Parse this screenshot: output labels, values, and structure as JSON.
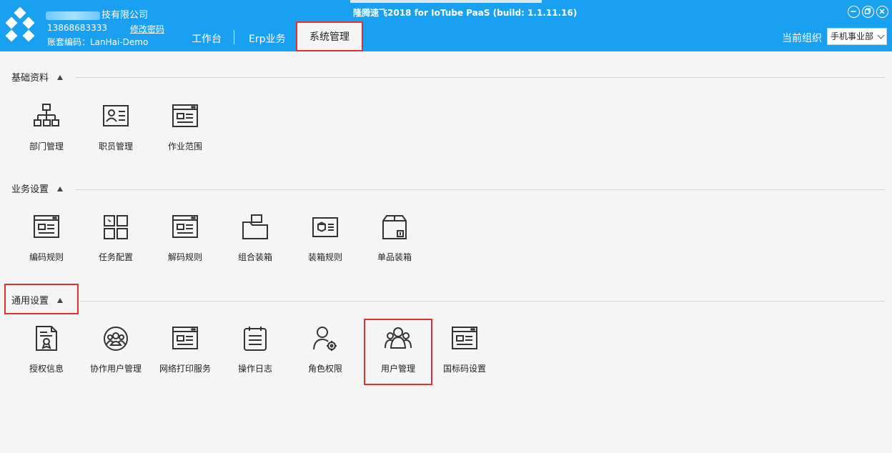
{
  "header": {
    "company_suffix": "技有限公司",
    "phone": "13868683333",
    "change_password": "修改密码",
    "account": "账套编码：LanHai-Demo",
    "app_title": "隆腾速飞2018 for IoTube PaaS (build: 1.1.11.16)",
    "nav": [
      "工作台",
      "Erp业务",
      "系统管理"
    ],
    "org_label": "当前组织",
    "org_value": "手机事业部",
    "colors": {
      "bar": "#1aa0f0",
      "highlight": "#e03030"
    }
  },
  "sections": [
    {
      "title": "基础资料",
      "items": [
        {
          "label": "部门管理",
          "icon": "org-chart-icon"
        },
        {
          "label": "职员管理",
          "icon": "id-card-icon"
        },
        {
          "label": "作业范围",
          "icon": "window-form-icon"
        }
      ]
    },
    {
      "title": "业务设置",
      "items": [
        {
          "label": "编码规则",
          "icon": "window-form-icon"
        },
        {
          "label": "任务配置",
          "icon": "layout-grid-icon"
        },
        {
          "label": "解码规则",
          "icon": "window-form-icon"
        },
        {
          "label": "组合装箱",
          "icon": "folder-box-icon"
        },
        {
          "label": "装箱规则",
          "icon": "box-card-icon"
        },
        {
          "label": "单品装箱",
          "icon": "package-icon"
        }
      ]
    },
    {
      "title": "通用设置",
      "items": [
        {
          "label": "授权信息",
          "icon": "certificate-icon"
        },
        {
          "label": "协作用户管理",
          "icon": "group-circle-icon"
        },
        {
          "label": "网络打印服务",
          "icon": "window-form-icon"
        },
        {
          "label": "操作日志",
          "icon": "calendar-log-icon"
        },
        {
          "label": "角色权限",
          "icon": "user-gear-icon"
        },
        {
          "label": "用户管理",
          "icon": "users-icon"
        },
        {
          "label": "国标码设置",
          "icon": "window-form-icon"
        }
      ]
    }
  ]
}
